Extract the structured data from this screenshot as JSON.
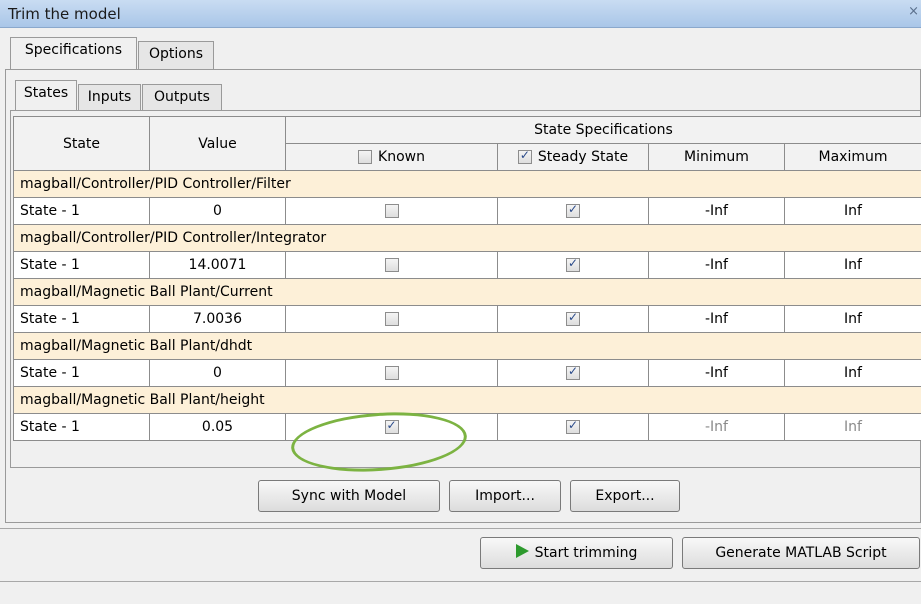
{
  "window": {
    "title": "Trim the model",
    "close_glyph": "×"
  },
  "tabs_top": [
    {
      "label": "Specifications",
      "active": true
    },
    {
      "label": "Options",
      "active": false
    }
  ],
  "tabs_sub": [
    {
      "label": "States",
      "active": true
    },
    {
      "label": "Inputs",
      "active": false
    },
    {
      "label": "Outputs",
      "active": false
    }
  ],
  "table": {
    "col_state": "State",
    "col_value": "Value",
    "col_specs": "State Specifications",
    "col_known": "Known",
    "col_steady": "Steady State",
    "col_min": "Minimum",
    "col_max": "Maximum",
    "known_header_checked": false,
    "steady_header_checked": true,
    "groups": [
      {
        "name": "magball/Controller/PID Controller/Filter",
        "state": "State - 1",
        "value": "0",
        "known": false,
        "steady": true,
        "min": "-Inf",
        "max": "Inf",
        "faded": false
      },
      {
        "name": "magball/Controller/PID Controller/Integrator",
        "state": "State - 1",
        "value": "14.0071",
        "known": false,
        "steady": true,
        "min": "-Inf",
        "max": "Inf",
        "faded": false
      },
      {
        "name": "magball/Magnetic Ball Plant/Current",
        "state": "State - 1",
        "value": "7.0036",
        "known": false,
        "steady": true,
        "min": "-Inf",
        "max": "Inf",
        "faded": false
      },
      {
        "name": "magball/Magnetic Ball Plant/dhdt",
        "state": "State - 1",
        "value": "0",
        "known": false,
        "steady": true,
        "min": "-Inf",
        "max": "Inf",
        "faded": false
      },
      {
        "name": "magball/Magnetic Ball Plant/height",
        "state": "State - 1",
        "value": "0.05",
        "known": true,
        "steady": true,
        "min": "-Inf",
        "max": "Inf",
        "faded": true
      }
    ]
  },
  "buttons": {
    "sync": "Sync with Model",
    "import": "Import...",
    "export": "Export...",
    "start": "Start trimming",
    "generate": "Generate MATLAB Script"
  },
  "colors": {
    "group_row_bg": "#fdf0d8",
    "highlight_ring": "#7cb342",
    "play_icon": "#2d9a2d",
    "titlebar": "#b8d1ee"
  }
}
